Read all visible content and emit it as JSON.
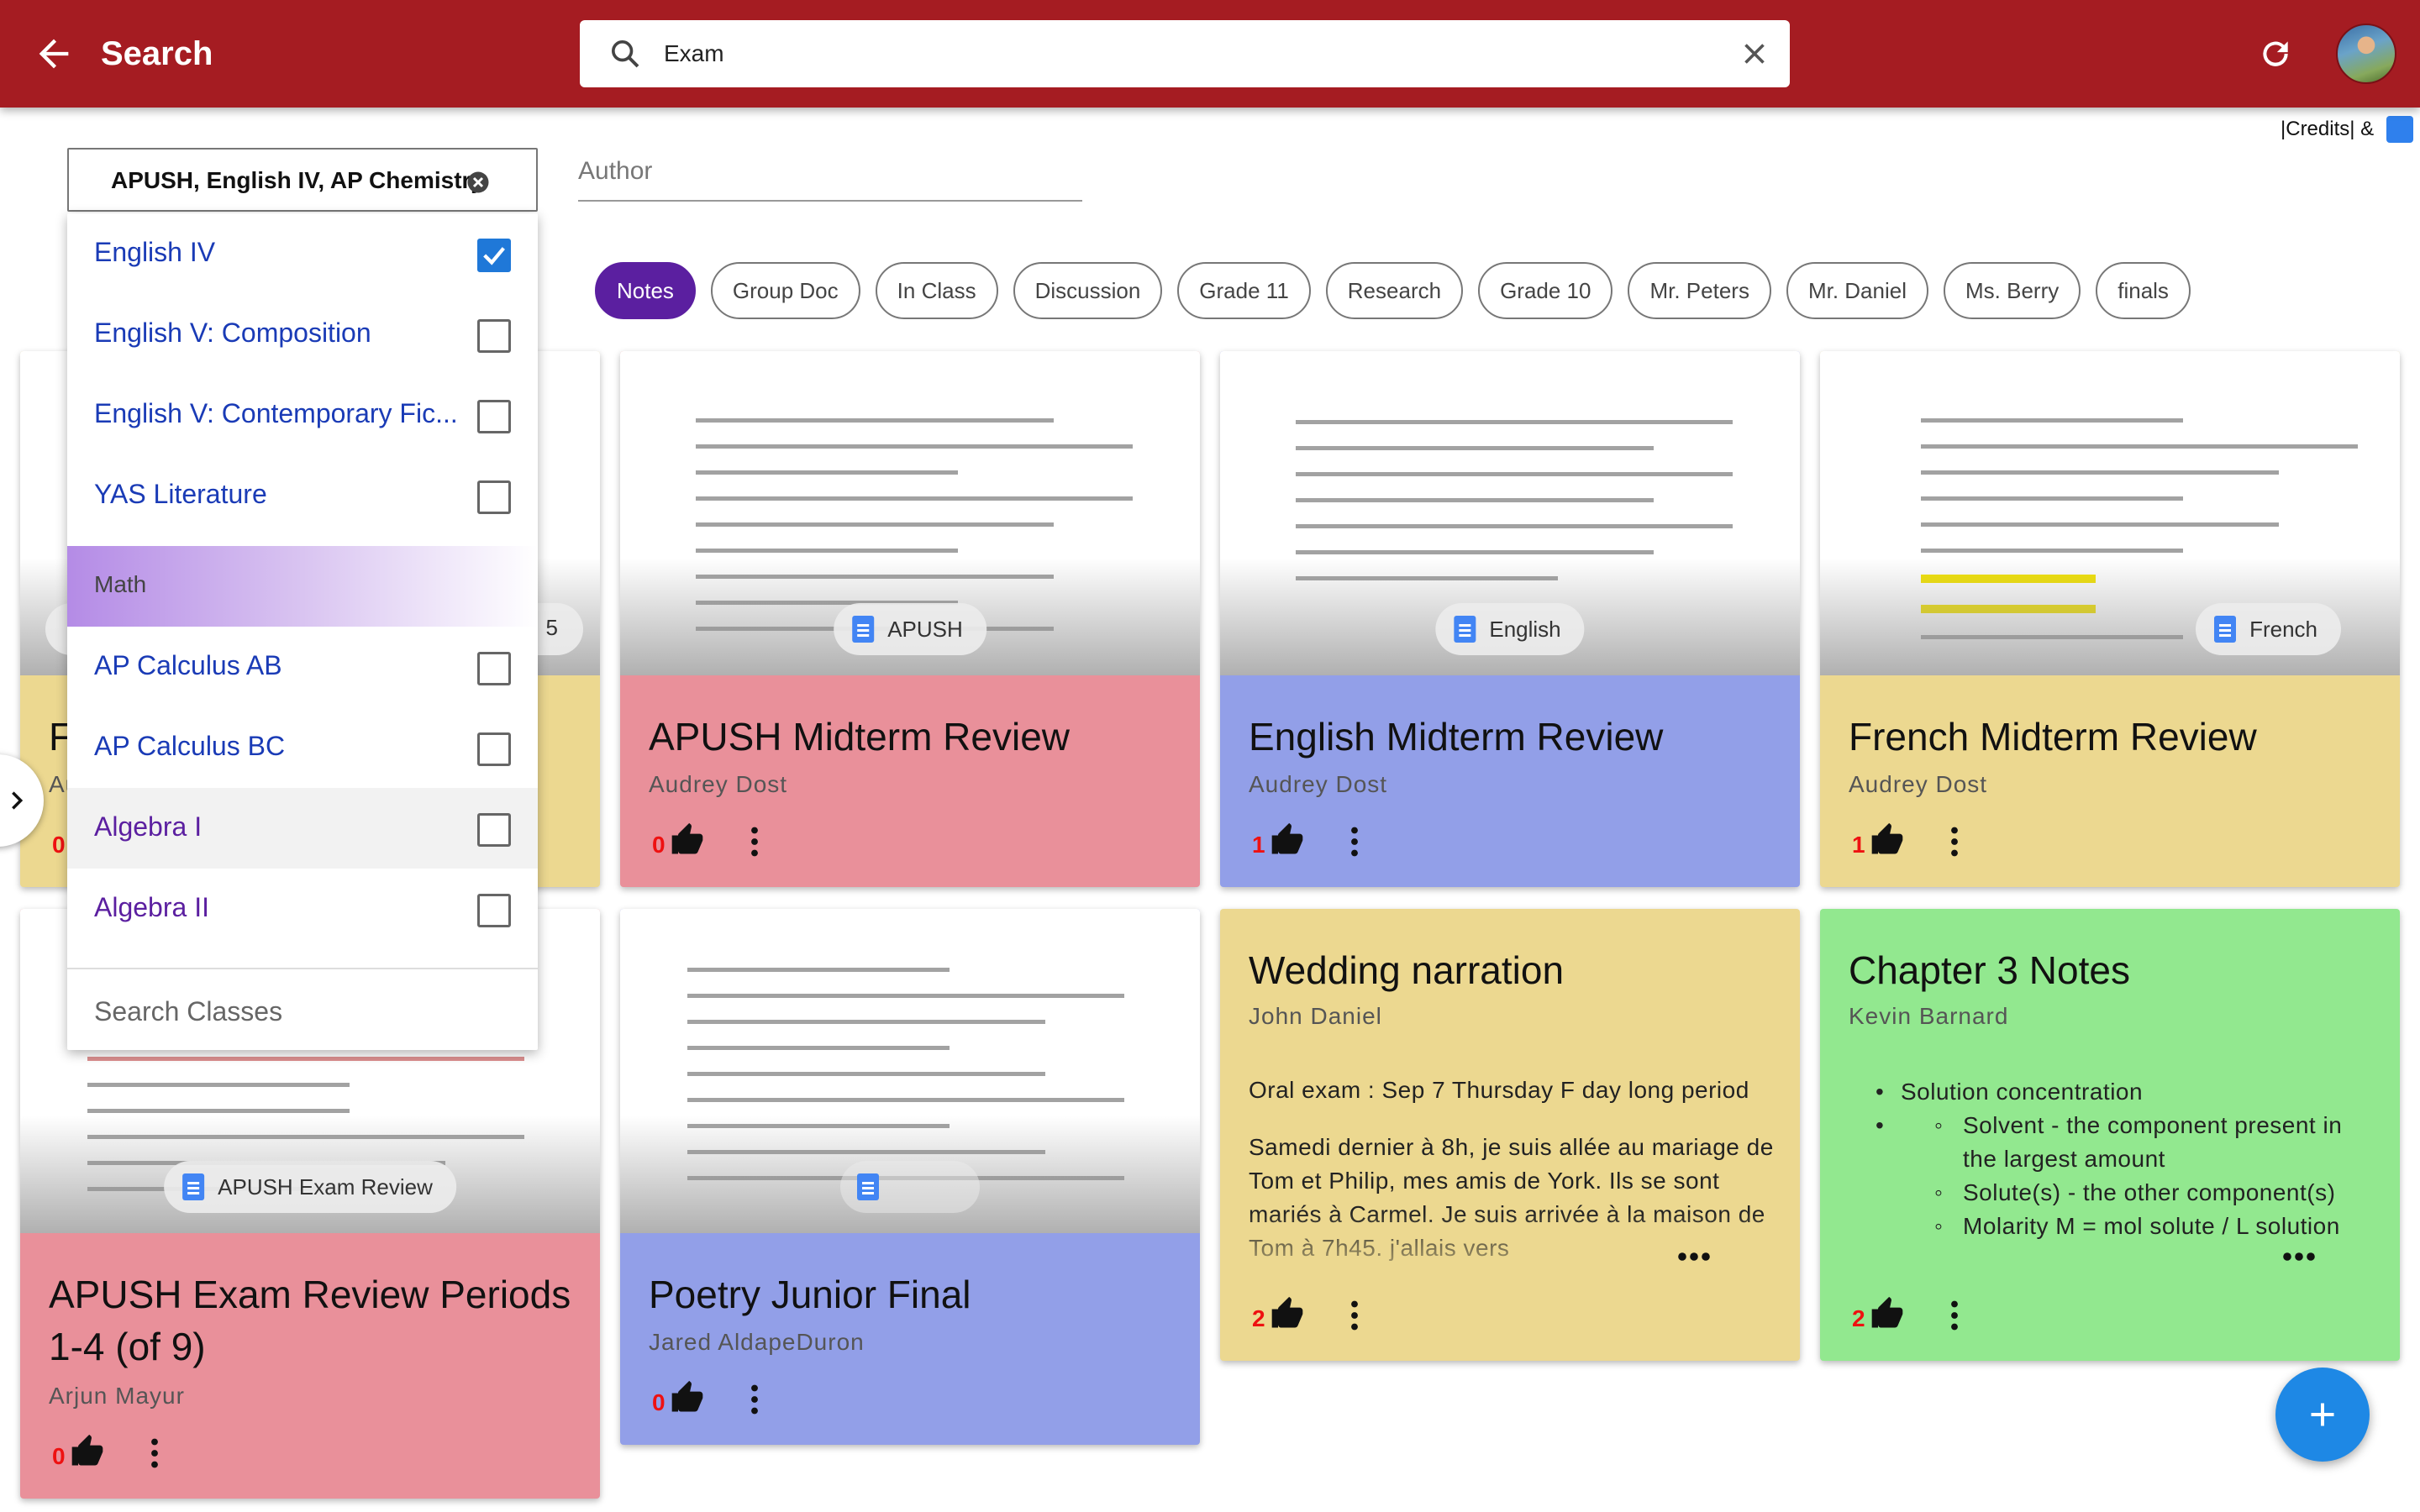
{
  "appbar": {
    "title": "Search",
    "search_value": "Exam",
    "icons": [
      "back-arrow-icon",
      "search-icon",
      "close-icon",
      "refresh-icon"
    ],
    "color": "#a51c22"
  },
  "credits": {
    "label": "|Credits| &"
  },
  "filters": {
    "class_select_value": "APUSH, English IV, AP Chemistry",
    "author_placeholder": "Author",
    "chips": [
      {
        "label": "Notes",
        "selected": true
      },
      {
        "label": "Group Doc"
      },
      {
        "label": "In Class"
      },
      {
        "label": "Discussion"
      },
      {
        "label": "Grade 11"
      },
      {
        "label": "Research"
      },
      {
        "label": "Grade 10"
      },
      {
        "label": "Mr. Peters"
      },
      {
        "label": "Mr. Daniel"
      },
      {
        "label": "Ms. Berry"
      },
      {
        "label": "finals"
      }
    ]
  },
  "dropdown": {
    "items": [
      {
        "label": "English IV",
        "checked": true
      },
      {
        "label": "English V: Composition",
        "checked": false
      },
      {
        "label": "English V: Contemporary Fic...",
        "checked": false
      },
      {
        "label": "YAS Literature",
        "checked": false
      }
    ],
    "group_label": "Math",
    "math_items": [
      {
        "label": "AP Calculus AB",
        "checked": false
      },
      {
        "label": "AP Calculus BC",
        "checked": false
      },
      {
        "label": "Algebra I",
        "checked": false
      },
      {
        "label": "Algebra II",
        "checked": false
      }
    ],
    "search_placeholder": "Search Classes"
  },
  "cards": [
    {
      "id": "c1",
      "partial_title": "F",
      "partial_author": "Au",
      "likes": "0",
      "chip_fragment": "5",
      "color": "#ecd890"
    },
    {
      "id": "c2",
      "title": "APUSH Midterm Review",
      "author": "Audrey Dost",
      "likes": "0",
      "doc_chip": "APUSH",
      "color": "#e9909a"
    },
    {
      "id": "c3",
      "title": "English Midterm Review",
      "author": "Audrey Dost",
      "likes": "1",
      "doc_chip": "English",
      "color": "#929fe8"
    },
    {
      "id": "c4",
      "title": "French Midterm Review",
      "author": "Audrey Dost",
      "likes": "1",
      "doc_chip": "French",
      "color": "#ecd890"
    },
    {
      "id": "c5",
      "title": "APUSH Exam Review Periods 1-4 (of 9)",
      "author": "Arjun Mayur",
      "likes": "0",
      "doc_chip": "APUSH Exam Review",
      "color": "#e9909a"
    },
    {
      "id": "c6",
      "title": "Poetry Junior Final",
      "author": "Jared AldapeDuron",
      "likes": "0",
      "color": "#929fe8"
    },
    {
      "id": "c7",
      "title": "Wedding narration",
      "author": "John Daniel",
      "likes": "2",
      "color": "#ecd890",
      "body_1": "Oral exam : Sep 7 Thursday F day long period",
      "body_2": "Samedi dernier à 8h, je suis allée au mariage de Tom et Philip, mes amis de York. Ils se sont mariés à Carmel. Je suis arrivée à la maison de Tom à 7h45. j'allais vers"
    },
    {
      "id": "c8",
      "title": "Chapter 3 Notes",
      "author": "Kevin Barnard",
      "likes": "2",
      "color": "#92e88f",
      "bullets": [
        "Solution concentration"
      ],
      "sub_bullets": [
        "Solvent - the component present in the largest amount",
        "Solute(s) - the other component(s)",
        "Molarity M = mol solute / L solution"
      ]
    }
  ]
}
